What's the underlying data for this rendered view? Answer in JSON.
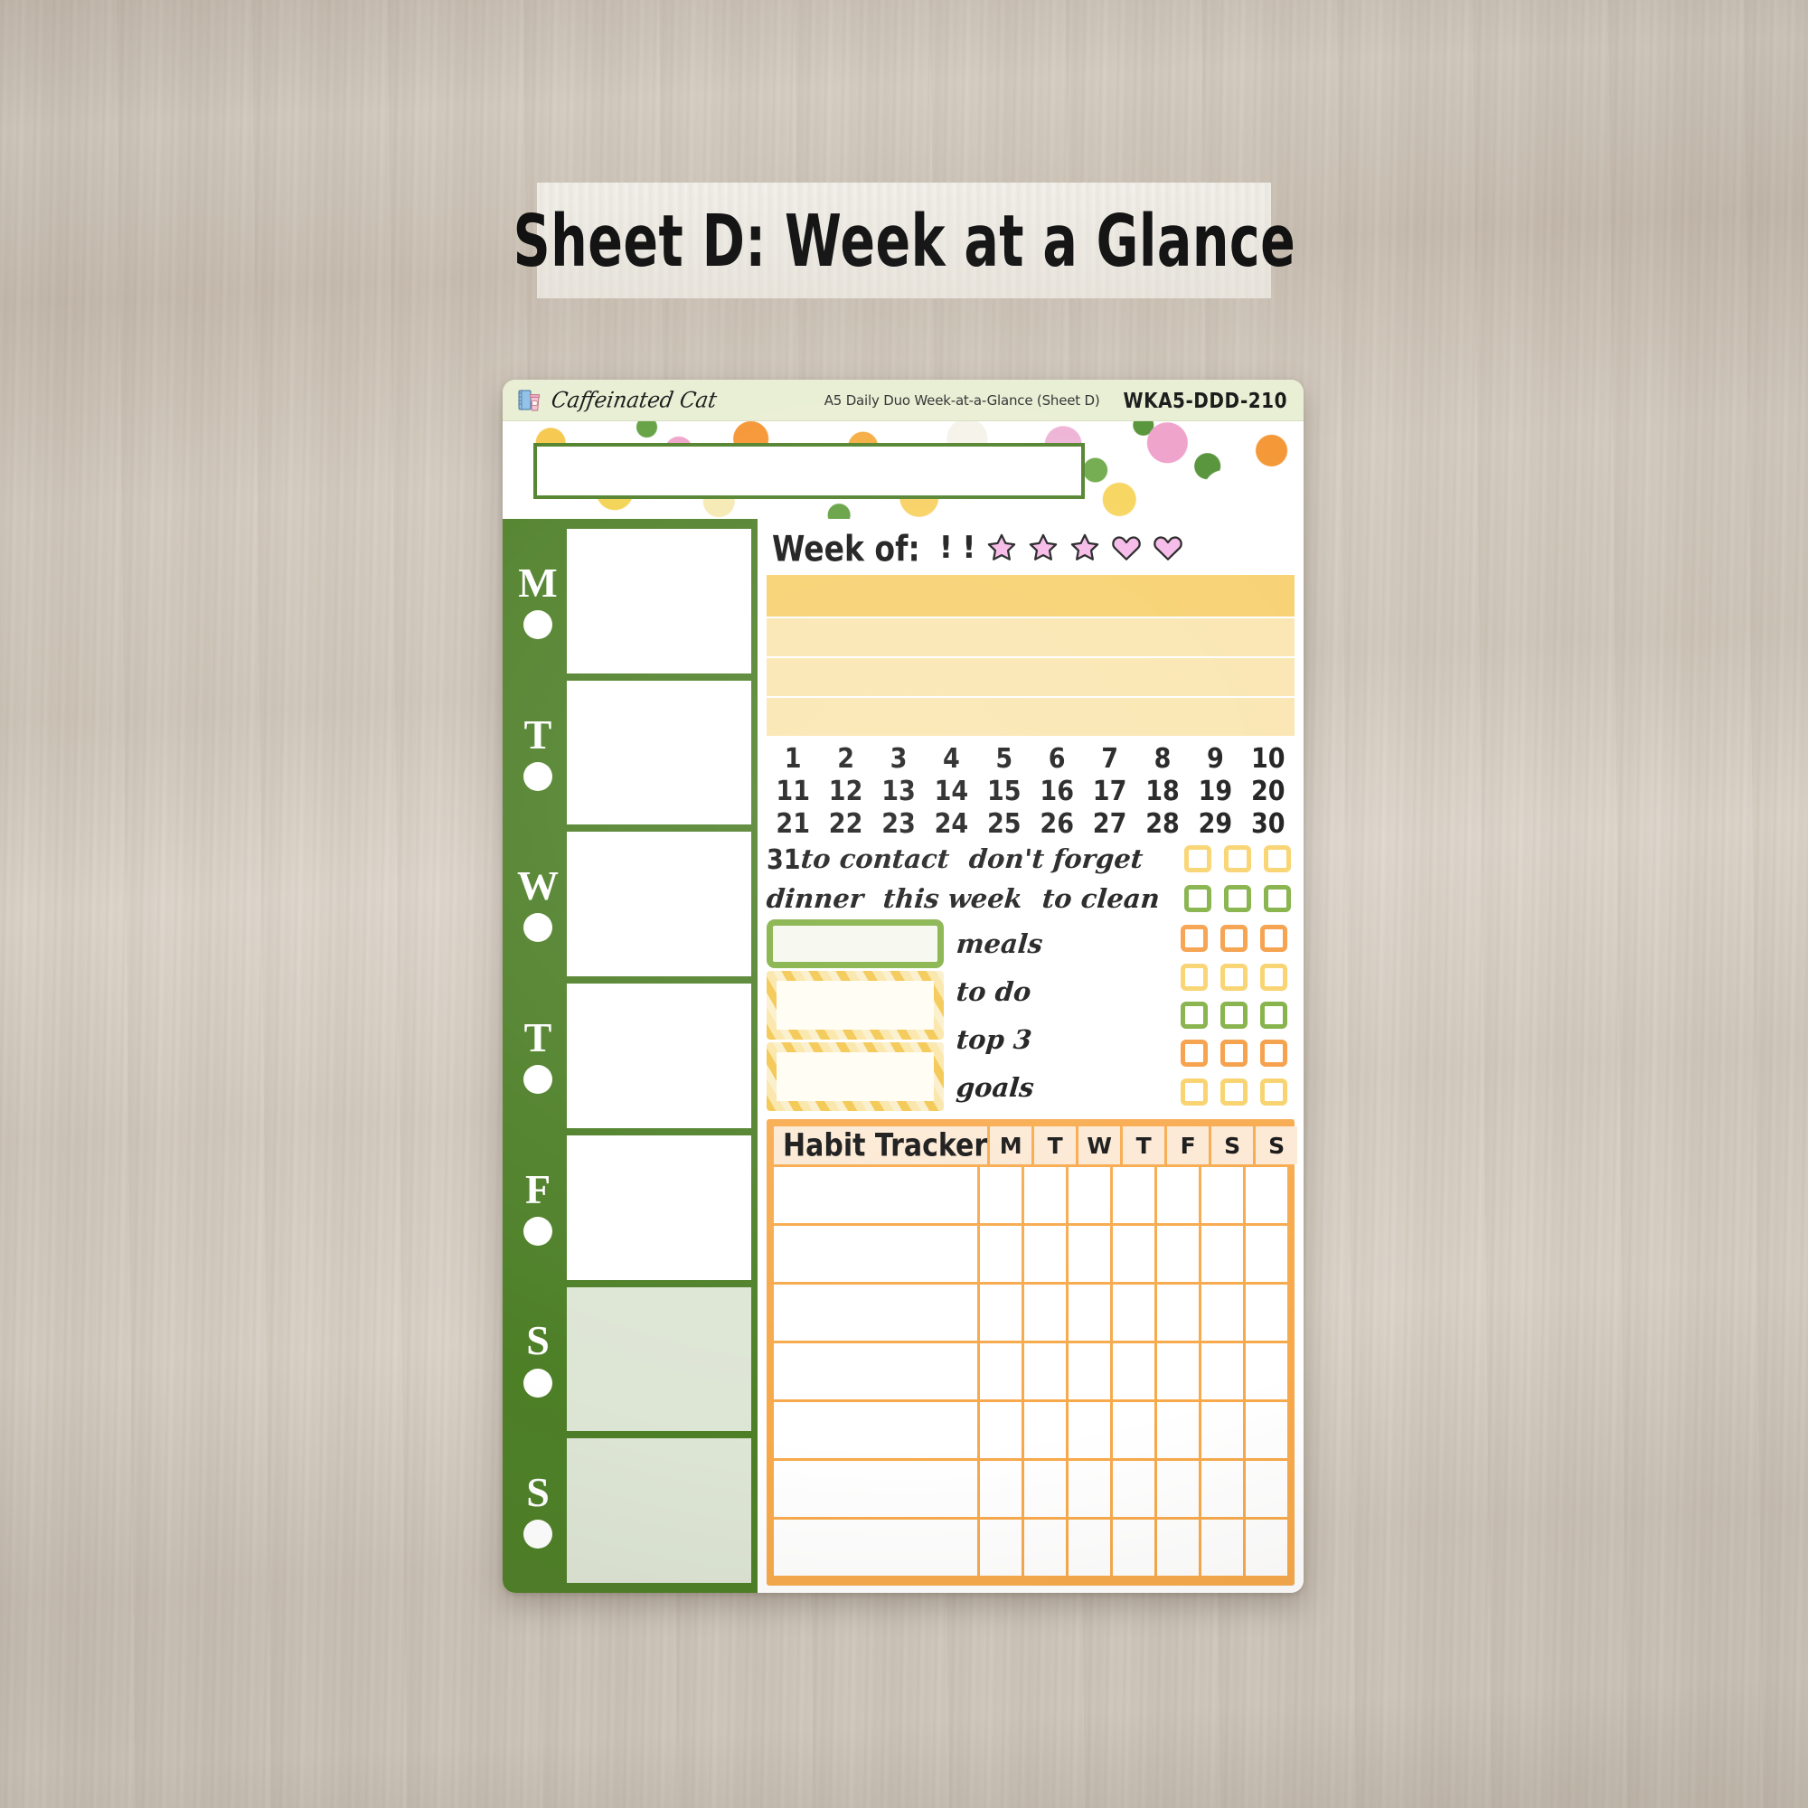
{
  "title_banner": {
    "text": "Sheet D: Week at a Glance"
  },
  "sheet": {
    "brand": {
      "name": "Caffeinated Cat",
      "logo_icon": "notebook-coffee-icon",
      "description": "A5 Daily Duo Week-at-a-Glance (Sheet D)",
      "code": "WKA5-DDD-210"
    },
    "floral_band": {
      "title_box_value": ""
    },
    "days": [
      {
        "letter": "M",
        "weekend": false
      },
      {
        "letter": "T",
        "weekend": false
      },
      {
        "letter": "W",
        "weekend": false
      },
      {
        "letter": "T",
        "weekend": false
      },
      {
        "letter": "F",
        "weekend": false
      },
      {
        "letter": "S",
        "weekend": true
      },
      {
        "letter": "S",
        "weekend": true
      }
    ],
    "week_of": {
      "label": "Week of:",
      "stickers": [
        "!",
        "!",
        "star",
        "star",
        "star",
        "heart",
        "heart"
      ],
      "sticker_fill": "#f6b7e8",
      "sticker_stroke": "#1a1a1a"
    },
    "yellow_bands": [
      {
        "tone": "dark",
        "color": "#f7cf6b"
      },
      {
        "tone": "light",
        "color": "#fae5ae"
      },
      {
        "tone": "light",
        "color": "#fae5ae"
      },
      {
        "tone": "light",
        "color": "#fae5ae"
      }
    ],
    "numbers": [
      1,
      2,
      3,
      4,
      5,
      6,
      7,
      8,
      9,
      10,
      11,
      12,
      13,
      14,
      15,
      16,
      17,
      18,
      19,
      20,
      21,
      22,
      23,
      24,
      25,
      26,
      27,
      28,
      29,
      30
    ],
    "word_rows": [
      {
        "num": "31",
        "words": [
          "to contact",
          "don't forget"
        ],
        "checkbox_color": "yellow"
      },
      {
        "num": "",
        "words": [
          "dinner",
          "this week",
          "to clean"
        ],
        "checkbox_color": "green"
      }
    ],
    "meals_labels": [
      "meals",
      "to do",
      "top 3",
      "goals"
    ],
    "meals_checkbox_colors": [
      "orange",
      "yellow",
      "green",
      "orange",
      "yellow"
    ],
    "habit_tracker": {
      "title": "Habit Tracker",
      "days": [
        "M",
        "T",
        "W",
        "T",
        "F",
        "S",
        "S"
      ],
      "row_count": 7,
      "accent": "#f7a94b",
      "header_cell": "#fce9d4"
    },
    "colors": {
      "green": "#4d7f27",
      "light_green": "#dde5d5",
      "brand_bar": "#e8eed2",
      "yellow_dark": "#f7cf6b",
      "yellow_light": "#fae5ae",
      "orange": "#f7a94b",
      "checkbox_green": "#7fae3f",
      "checkbox_orange": "#f59c42",
      "checkbox_yellow": "#f8d168"
    }
  }
}
